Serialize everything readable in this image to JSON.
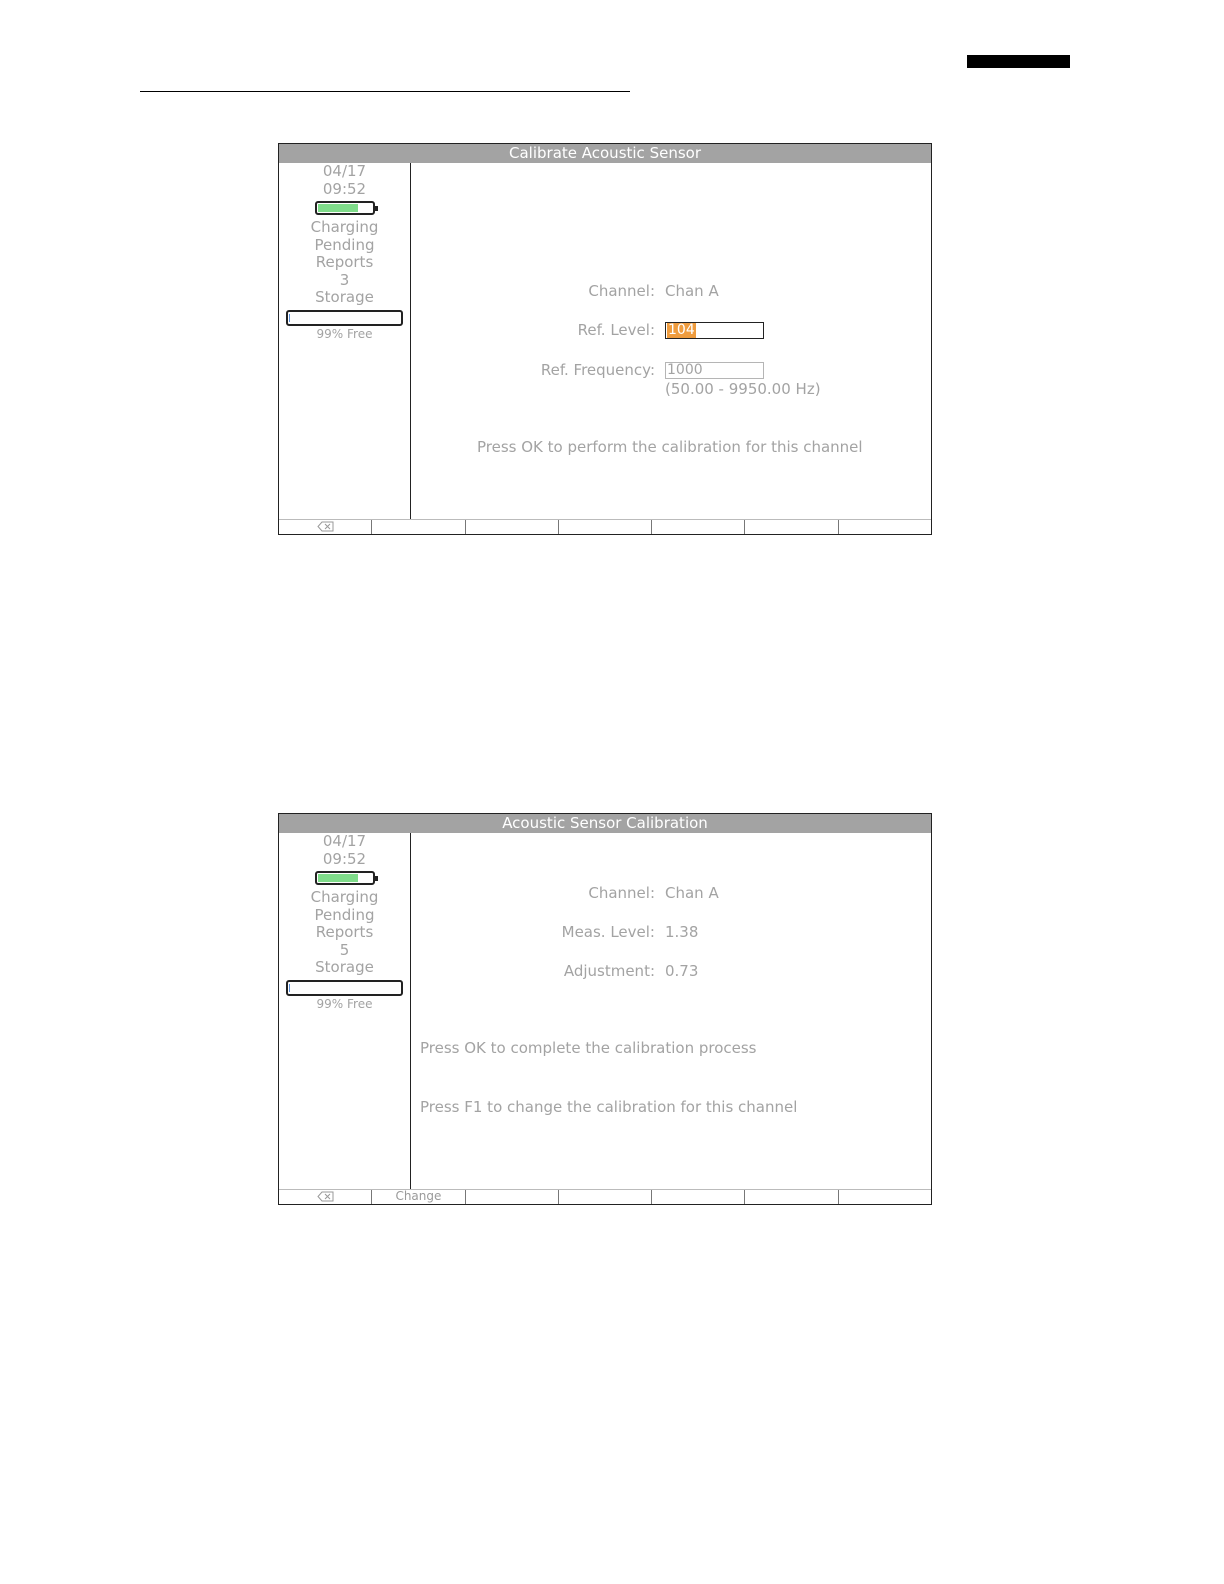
{
  "screens": [
    {
      "title": "Calibrate Acoustic Sensor",
      "sidebar": {
        "date": "04/17",
        "time": "09:52",
        "battery_level": 0.72,
        "battery_color": "#7fdc8a",
        "battery_status": "Charging",
        "pending_label_1": "Pending",
        "pending_label_2": "Reports",
        "pending_count": "3",
        "storage_label": "Storage",
        "storage_used_fraction": 0.01,
        "storage_free": "99% Free"
      },
      "channel_label": "Channel:",
      "channel_value": "Chan A",
      "ref_level_label": "Ref. Level:",
      "ref_level_value": "104",
      "ref_freq_label": "Ref. Frequency:",
      "ref_freq_value": "1000",
      "ref_freq_range": "(50.00 - 9950.00 Hz)",
      "message": "Press OK to perform the calibration for this channel",
      "highlight_color": "#ef9c3e",
      "softkeys": [
        {
          "icon": "backspace-icon",
          "label": ""
        },
        {
          "label": ""
        },
        {
          "label": ""
        },
        {
          "label": ""
        },
        {
          "label": ""
        },
        {
          "label": ""
        },
        {
          "label": ""
        }
      ]
    },
    {
      "title": "Acoustic Sensor Calibration",
      "sidebar": {
        "date": "04/17",
        "time": "09:52",
        "battery_level": 0.72,
        "battery_color": "#7fdc8a",
        "battery_status": "Charging",
        "pending_label_1": "Pending",
        "pending_label_2": "Reports",
        "pending_count": "5",
        "storage_label": "Storage",
        "storage_used_fraction": 0.01,
        "storage_free": "99% Free"
      },
      "channel_label": "Channel:",
      "channel_value": "Chan A",
      "meas_level_label": "Meas. Level:",
      "meas_level_value": "1.38",
      "adjustment_label": "Adjustment:",
      "adjustment_value": "0.73",
      "message_ok": "Press OK to complete the calibration process",
      "message_f1": "Press F1 to change the calibration for this channel",
      "softkeys": [
        {
          "icon": "backspace-icon",
          "label": ""
        },
        {
          "label": "Change"
        },
        {
          "label": ""
        },
        {
          "label": ""
        },
        {
          "label": ""
        },
        {
          "label": ""
        },
        {
          "label": ""
        }
      ]
    }
  ]
}
